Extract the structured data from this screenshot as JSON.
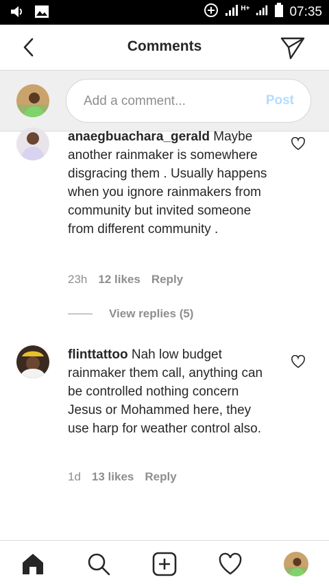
{
  "status_bar": {
    "time": "07:35",
    "network_label": "H+"
  },
  "header": {
    "title": "Comments"
  },
  "composer": {
    "placeholder": "Add a comment...",
    "post_label": "Post"
  },
  "comments": [
    {
      "username": "anaegbuachara_gerald",
      "text": "Maybe another rainmaker is somewhere disgracing them . Usually happens when you ignore rainmakers from community but invited someone from different community .",
      "time": "23h",
      "likes": "12 likes",
      "reply_label": "Reply",
      "view_replies": "View replies (5)"
    },
    {
      "username": "flinttattoo",
      "text": "Nah low budget rainmaker them call, anything can be controlled nothing concern Jesus or Mohammed here, they use harp for weather control also.",
      "time": "1d",
      "likes": "13 likes",
      "reply_label": "Reply"
    }
  ],
  "tab_bar": {
    "icons": [
      "home-icon",
      "search-icon",
      "add-post-icon",
      "activity-heart-icon",
      "profile-avatar"
    ]
  },
  "colors": {
    "post_disabled": "#b3dbff",
    "muted_text": "#8e8e8e",
    "primary_text": "#262626"
  }
}
